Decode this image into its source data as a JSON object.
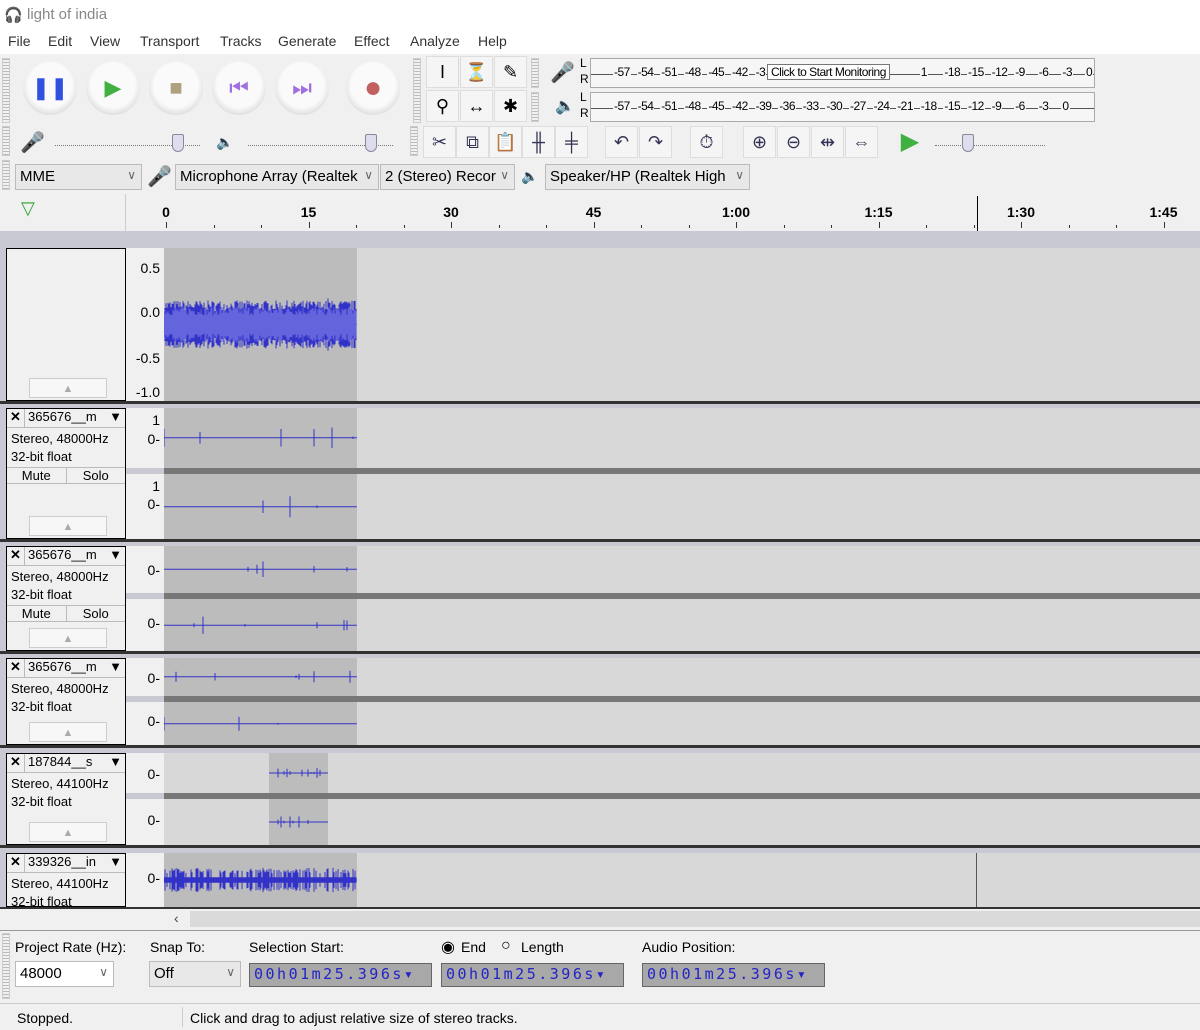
{
  "window": {
    "title": "light of india"
  },
  "menu": [
    "File",
    "Edit",
    "View",
    "Transport",
    "Tracks",
    "Generate",
    "Effect",
    "Analyze",
    "Help"
  ],
  "transport": [
    {
      "name": "pause",
      "color": "#3050e0"
    },
    {
      "name": "play",
      "color": "#40b040"
    },
    {
      "name": "stop",
      "color": "#b0a080"
    },
    {
      "name": "skip-start",
      "color": "#a070e0"
    },
    {
      "name": "skip-end",
      "color": "#a070e0"
    },
    {
      "name": "record",
      "color": "#c06060"
    }
  ],
  "tools": [
    "selection-tool",
    "envelope-tool",
    "draw-tool",
    "zoom-tool",
    "time-shift-tool",
    "multi-tool"
  ],
  "meters": {
    "record": {
      "scale": [
        "-57",
        "-54",
        "-51",
        "-48",
        "-45",
        "-42",
        "-3",
        "",
        "",
        "",
        "",
        "",
        "",
        "1",
        "-18",
        "-15",
        "-12",
        "-9",
        "-6",
        "-3",
        "0"
      ],
      "tooltip": "Click to Start Monitoring",
      "l": "L",
      "r": "R"
    },
    "playback": {
      "scale": [
        "-57",
        "-54",
        "-51",
        "-48",
        "-45",
        "-42",
        "-39",
        "-36",
        "-33",
        "-30",
        "-27",
        "-24",
        "-21",
        "-18",
        "-15",
        "-12",
        "-9",
        "-6",
        "-3",
        "0"
      ],
      "l": "L",
      "r": "R"
    }
  },
  "mixer": {
    "record_volume": 0.85,
    "playback_volume": 0.85,
    "minus": "-",
    "plus": "+"
  },
  "play_at_speed": {
    "value": 0.3,
    "minus": "-",
    "plus": "+"
  },
  "devices": {
    "host": "MME",
    "input": "Microphone Array (Realtek",
    "channels": "2 (Stereo) Recor",
    "output": "Speaker/HP (Realtek High"
  },
  "timeline": {
    "labels": [
      "0",
      "15",
      "30",
      "45",
      "1:00",
      "1:15",
      "1:30",
      "1:45"
    ],
    "seconds": [
      0,
      15,
      30,
      45,
      60,
      75,
      90,
      105
    ],
    "playhead_seconds": 85.396
  },
  "tracks": [
    {
      "name": "",
      "info": [],
      "scale": [
        "0.5",
        "0.0",
        "-0.5",
        "-1.0"
      ],
      "stereo": false,
      "clip": [
        0,
        20.3
      ],
      "style": "dense"
    },
    {
      "name": "365676__m",
      "info": [
        "Stereo, 48000Hz",
        "32-bit float"
      ],
      "scale": [
        "1",
        "0-"
      ],
      "stereo": true,
      "clip": [
        0,
        20.3
      ],
      "style": "sparse",
      "mute": "Mute",
      "solo": "Solo"
    },
    {
      "name": "365676__m",
      "info": [
        "Stereo, 48000Hz",
        "32-bit float"
      ],
      "scale": [
        "0-"
      ],
      "stereo": true,
      "clip": [
        0,
        20.3
      ],
      "style": "sparse",
      "mute": "Mute",
      "solo": "Solo"
    },
    {
      "name": "365676__m",
      "info": [
        "Stereo, 48000Hz",
        "32-bit float"
      ],
      "scale": [
        "0-"
      ],
      "stereo": true,
      "clip": [
        0,
        20.3
      ],
      "style": "sparse"
    },
    {
      "name": "187844__s",
      "info": [
        "Stereo, 44100Hz",
        "32-bit float"
      ],
      "scale": [
        "0-"
      ],
      "stereo": true,
      "clip": [
        11,
        17.3
      ],
      "style": "burst"
    },
    {
      "name": "339326__in",
      "info": [
        "Stereo, 44100Hz",
        "32-bit float"
      ],
      "scale": [
        "0-"
      ],
      "stereo": false,
      "clip": [
        0,
        20.3
      ],
      "style": "medium"
    }
  ],
  "selection_toolbar": {
    "project_rate_label": "Project Rate (Hz):",
    "project_rate": "48000",
    "snap_label": "Snap To:",
    "snap": "Off",
    "sel_start_label": "Selection Start:",
    "end_label": "End",
    "length_label": "Length",
    "end_selected": true,
    "audio_pos_label": "Audio Position:",
    "sel_start": "00h01m25.396s",
    "sel_end": "00h01m25.396s",
    "audio_pos": "00h01m25.396s"
  },
  "status": {
    "state": "Stopped.",
    "hint": "Click and drag to adjust relative size of stereo tracks."
  }
}
